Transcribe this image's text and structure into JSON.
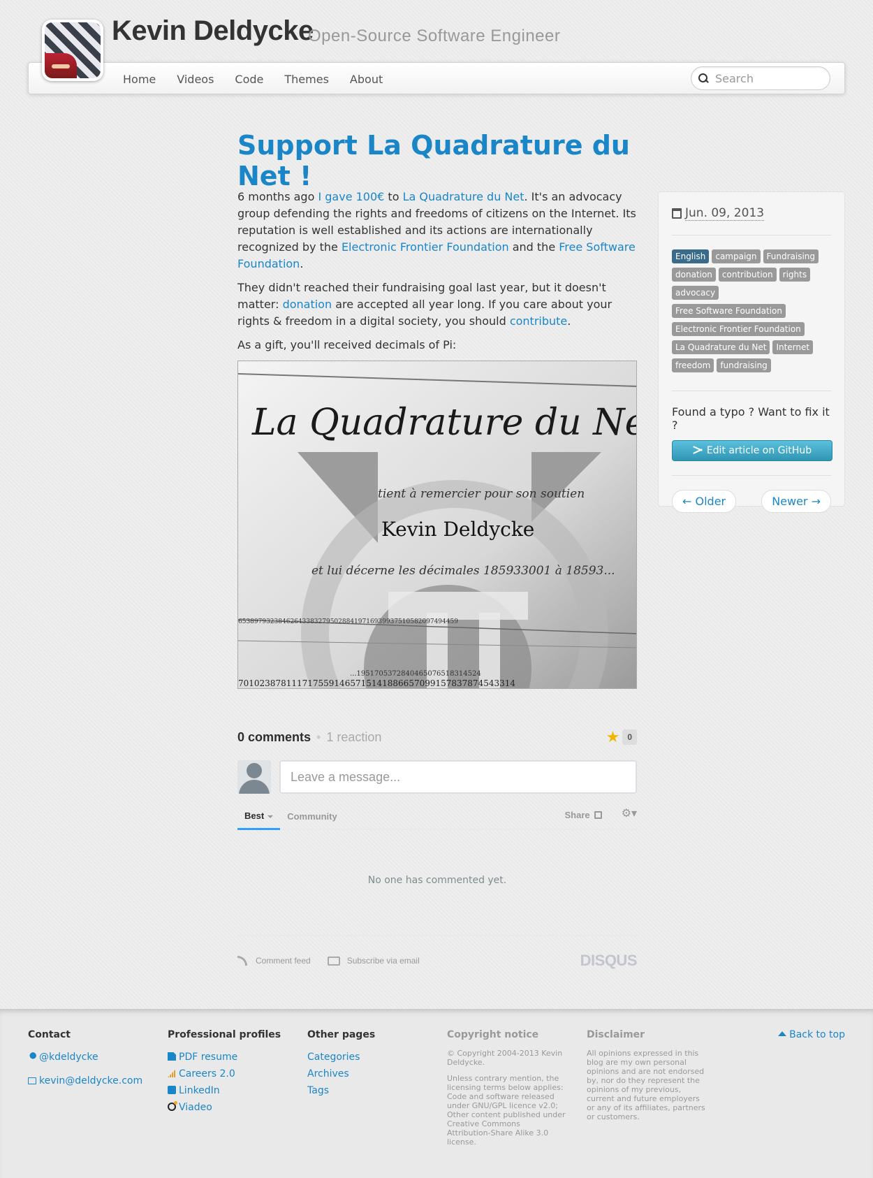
{
  "header": {
    "title": "Kevin Deldycke",
    "subtitle": "Open-Source Software Engineer"
  },
  "nav": {
    "items": [
      "Home",
      "Videos",
      "Code",
      "Themes",
      "About"
    ],
    "search_placeholder": "Search"
  },
  "article": {
    "title": "Support La Quadrature du Net !",
    "p1": {
      "t1": "6 months ago ",
      "link1": "I gave 100€",
      "t2": " to ",
      "link2": "La Quadrature du Net",
      "t3": ". It's an advocacy group defending the rights and freedoms of citizens on the Internet. Its reputation is well established and its actions are internationally recognized by the ",
      "link3": "Electronic Frontier Foundation",
      "t4": " and the ",
      "link4": "Free Software Foundation",
      "t5": "."
    },
    "p2": {
      "t1": "They didn't reached their fundraising goal last year, but it doesn't matter: ",
      "link1": "donation",
      "t2": " are accepted all year long. If you care about your rights & freedom in a digital society, you should ",
      "link2": "contribute",
      "t3": "."
    },
    "p3": "As a gift, you'll received decimals of Pi:",
    "photo": {
      "heading": "La Quadrature du Net",
      "line1": "tient à remercier pour son soutien",
      "name": "Kevin Deldycke",
      "line2": "et lui décerne les décimales 185933001 à 18593...",
      "digits1": "6538979323846264338327950288419716939937510582097494459",
      "digits2": "7010238781117175591465715141886657099157837874543314",
      "digits3": "...1951705372840465076518314524"
    }
  },
  "sidebar": {
    "date": "Jun. 09, 2013",
    "tags": [
      "English",
      "campaign",
      "Fundraising",
      "donation",
      "contribution",
      "rights",
      "advocacy",
      "Free Software Foundation",
      "Electronic Frontier Foundation",
      "La Quadrature du Net",
      "Internet",
      "freedom",
      "fundraising"
    ],
    "typo_text": "Found a typo ? Want to fix it ?",
    "edit_button": "Edit article on GitHub",
    "older": "← Older",
    "newer": "Newer →"
  },
  "comments": {
    "count": "0 comments",
    "reactions": "1 reaction",
    "star_count": "0",
    "placeholder": "Leave a message...",
    "tab_best": "Best",
    "tab_community": "Community",
    "share": "Share",
    "empty": "No one has commented yet.",
    "feed": "Comment feed",
    "subscribe": "Subscribe via email",
    "brand": "DISQUS"
  },
  "footer": {
    "contact": {
      "heading": "Contact",
      "twitter": "@kdeldycke",
      "email": "kevin@deldycke.com"
    },
    "profiles": {
      "heading": "Professional profiles",
      "items": [
        "PDF resume",
        "Careers 2.0",
        "LinkedIn",
        "Viadeo"
      ]
    },
    "other": {
      "heading": "Other pages",
      "items": [
        "Categories",
        "Archives",
        "Tags"
      ]
    },
    "copyright": {
      "heading": "Copyright notice",
      "p1": "© Copyright 2004-2013 Kevin Deldycke.",
      "p2": "Unless contrary mention, the licensing terms below applies:",
      "p3": "Code and software released under GNU/GPL licence v2.0;",
      "p4": "Other content published under Creative Commons Attribution-Share Alike 3.0 license."
    },
    "disclaimer": {
      "heading": "Disclaimer",
      "text": "All opinions expressed in this blog are my own personal opinions and are not endorsed by, nor do they represent the opinions of my previous, current and future employers or any of its affiliates, partners or customers."
    },
    "back_to_top": "Back to top"
  }
}
